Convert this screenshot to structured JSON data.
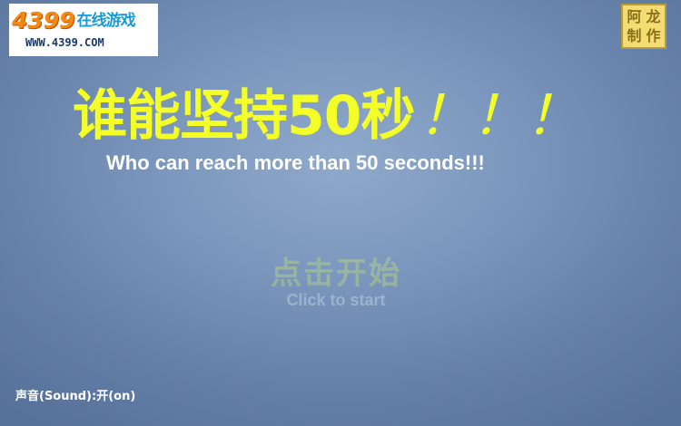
{
  "logo": {
    "number": "4399",
    "chinese": "在线游戏",
    "url": "WWW.4399.COM"
  },
  "stamp": {
    "chars": [
      "阿",
      "龙",
      "制",
      "作"
    ],
    "color": "#f4dc74"
  },
  "title": {
    "chinese": "谁能坚持50秒",
    "exclaim": "！！！",
    "english": "Who can reach more than 50 seconds!!!",
    "color": "#f4ff28"
  },
  "start": {
    "chinese": "点击开始",
    "english": "Click to start"
  },
  "sound": {
    "label": "声音(Sound):开(on)"
  },
  "background_color": "#7b97bd"
}
